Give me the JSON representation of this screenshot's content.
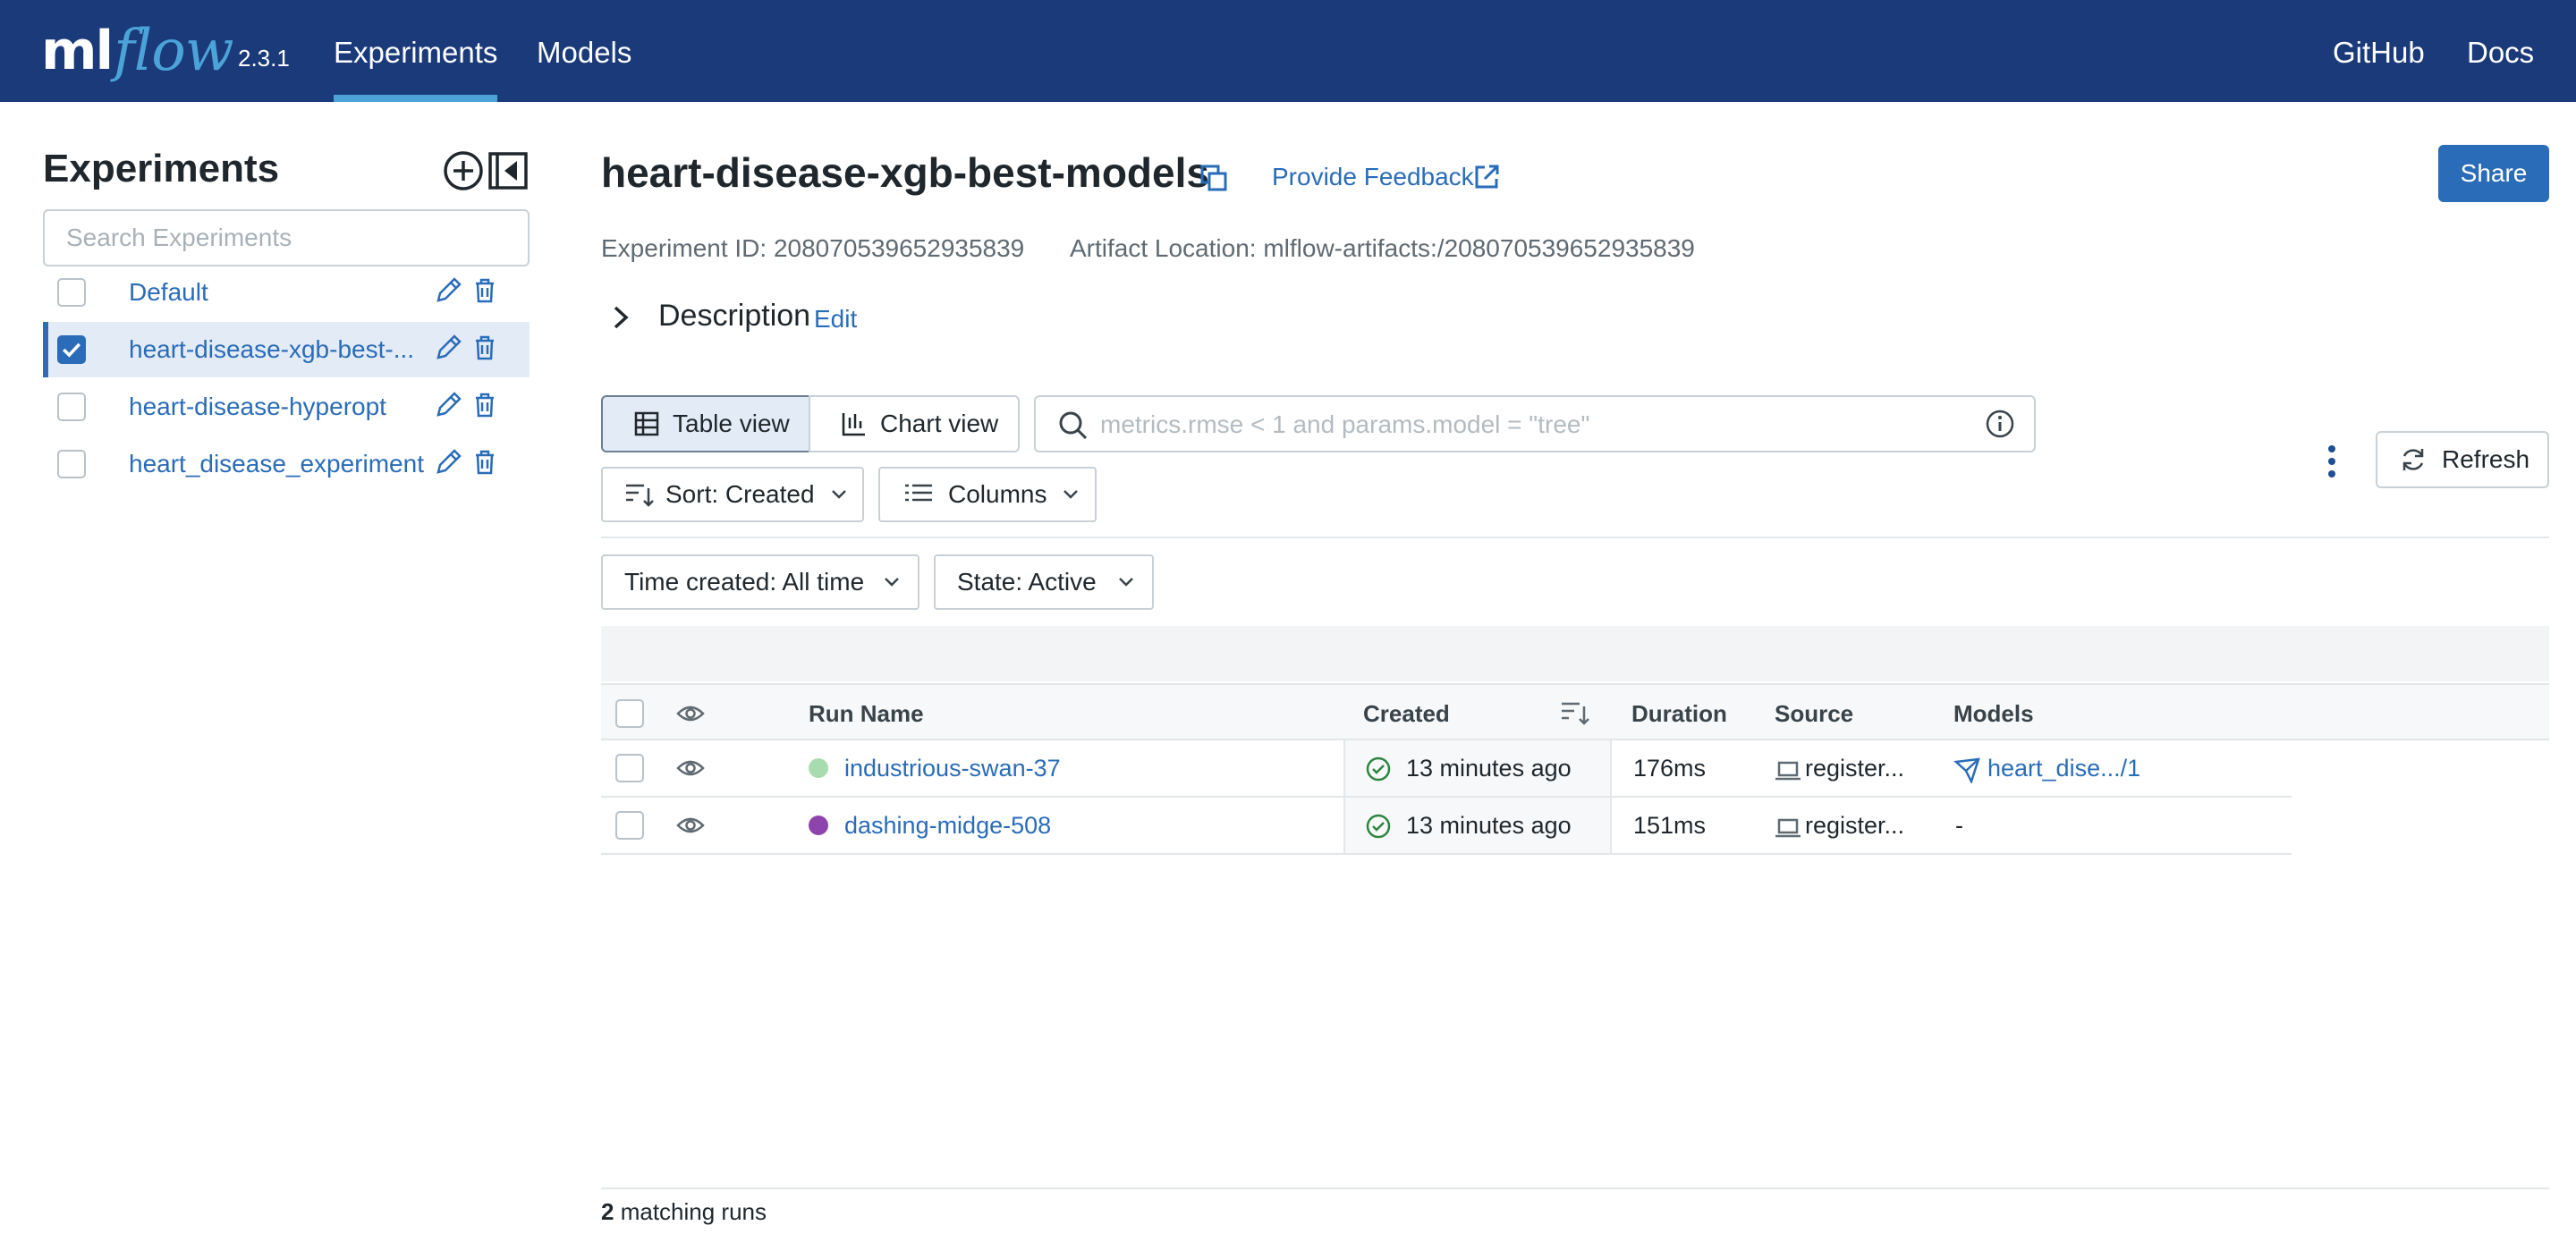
{
  "header": {
    "logo_ml": "ml",
    "logo_flow": "flow",
    "version": "2.3.1",
    "tabs": [
      {
        "label": "Experiments",
        "active": true
      },
      {
        "label": "Models",
        "active": false
      }
    ],
    "links": [
      {
        "label": "GitHub"
      },
      {
        "label": "Docs"
      }
    ]
  },
  "sidebar": {
    "title": "Experiments",
    "search_placeholder": "Search Experiments",
    "items": [
      {
        "label": "Default",
        "checked": false
      },
      {
        "label": "heart-disease-xgb-best-...",
        "checked": true
      },
      {
        "label": "heart-disease-hyperopt",
        "checked": false
      },
      {
        "label": "heart_disease_experiment",
        "checked": false
      }
    ]
  },
  "main": {
    "title": "heart-disease-xgb-best-models",
    "feedback_label": "Provide Feedback",
    "share_label": "Share",
    "experiment_id": "Experiment ID: 208070539652935839",
    "artifact_location": "Artifact Location: mlflow-artifacts:/208070539652935839",
    "description_label": "Description",
    "description_edit": "Edit"
  },
  "controls": {
    "table_view": "Table view",
    "chart_view": "Chart view",
    "filter_placeholder": "metrics.rmse < 1 and params.model = \"tree\"",
    "refresh": "Refresh",
    "sort": "Sort: Created",
    "columns": "Columns",
    "time_created": "Time created: All time",
    "state": "State: Active"
  },
  "table": {
    "columns": {
      "run_name": "Run Name",
      "created": "Created",
      "duration": "Duration",
      "source": "Source",
      "models": "Models"
    },
    "rows": [
      {
        "run_name": "industrious-swan-37",
        "color": "#a8dcb0",
        "created": "13 minutes ago",
        "duration": "176ms",
        "source": "register...",
        "models": "heart_dise.../1"
      },
      {
        "run_name": "dashing-midge-508",
        "color": "#8e44ad",
        "created": "13 minutes ago",
        "duration": "151ms",
        "source": "register...",
        "models": "-"
      }
    ]
  },
  "footer": {
    "count": "2",
    "label": "matching runs"
  },
  "colors": {
    "nav_bg": "#1b3a7a",
    "accent": "#2a6cb8",
    "success": "#2e8540"
  }
}
